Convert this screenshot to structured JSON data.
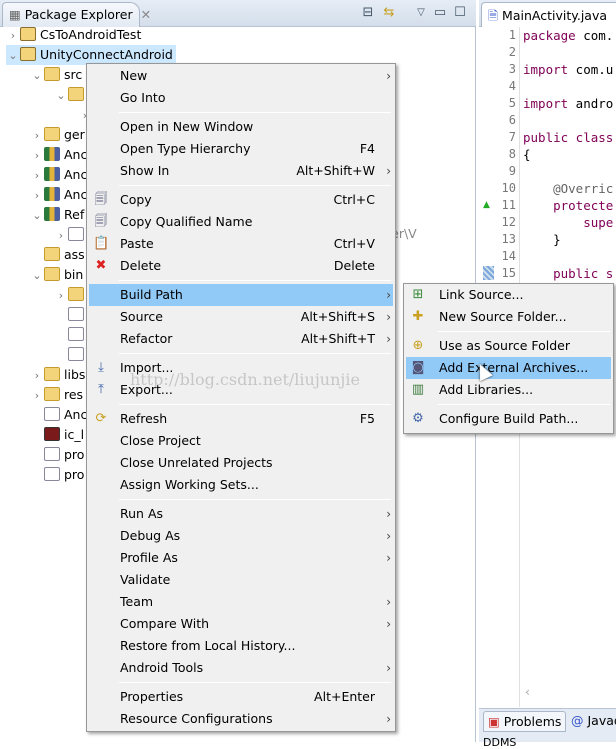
{
  "left_panel": {
    "tab_label": "Package Explorer",
    "tree": [
      {
        "label": "CsToAndroidTest",
        "indent": 0,
        "twisty": ">",
        "icon": "project-icon"
      },
      {
        "label": "UnityConnectAndroid",
        "indent": 0,
        "twisty": "v",
        "icon": "project-icon",
        "selected": true
      },
      {
        "label": "src",
        "indent": 1,
        "twisty": "v",
        "icon": "source-folder-icon"
      },
      {
        "label": "",
        "indent": 2,
        "twisty": "v",
        "icon": "package-icon"
      },
      {
        "label": "",
        "indent": 3,
        "twisty": ">",
        "icon": ""
      },
      {
        "label": "ger",
        "indent": 1,
        "twisty": ">",
        "icon": "source-folder-icon"
      },
      {
        "label": "Anc",
        "indent": 1,
        "twisty": ">",
        "icon": "library-icon"
      },
      {
        "label": "Anc",
        "indent": 1,
        "twisty": ">",
        "icon": "library-icon"
      },
      {
        "label": "Anc",
        "indent": 1,
        "twisty": ">",
        "icon": "library-icon"
      },
      {
        "label": "Ref",
        "indent": 1,
        "twisty": "v",
        "icon": "library-icon"
      },
      {
        "label": "",
        "indent": 2,
        "twisty": ">",
        "icon": "jar-icon"
      },
      {
        "label": "ass",
        "indent": 1,
        "twisty": "",
        "icon": "folder-icon"
      },
      {
        "label": "bin",
        "indent": 1,
        "twisty": "v",
        "icon": "folder-icon"
      },
      {
        "label": "",
        "indent": 2,
        "twisty": ">",
        "icon": "folder-icon"
      },
      {
        "label": "",
        "indent": 2,
        "twisty": "",
        "icon": "android-file-icon"
      },
      {
        "label": "",
        "indent": 2,
        "twisty": "",
        "icon": "file-icon"
      },
      {
        "label": "",
        "indent": 2,
        "twisty": "",
        "icon": "java-file-icon"
      },
      {
        "label": "libs",
        "indent": 1,
        "twisty": ">",
        "icon": "folder-icon"
      },
      {
        "label": "res",
        "indent": 1,
        "twisty": ">",
        "icon": "folder-icon"
      },
      {
        "label": "Anc",
        "indent": 1,
        "twisty": "",
        "icon": "android-file-icon"
      },
      {
        "label": "ic_l",
        "indent": 1,
        "twisty": "",
        "icon": "png-icon"
      },
      {
        "label": "pro",
        "indent": 1,
        "twisty": "",
        "icon": "file-icon"
      },
      {
        "label": "pro",
        "indent": 1,
        "twisty": "",
        "icon": "file-icon"
      }
    ],
    "obscured_text": "oidPlayer\\V"
  },
  "editor": {
    "tab_label": "MainActivity.java",
    "lines": [
      {
        "n": "1",
        "kw": "package",
        "rest": " com."
      },
      {
        "n": "2",
        "kw": "",
        "rest": ""
      },
      {
        "n": "3",
        "kw": "import",
        "rest": " com.u"
      },
      {
        "n": "4",
        "kw": "",
        "rest": ""
      },
      {
        "n": "5",
        "kw": "import",
        "rest": " andro"
      },
      {
        "n": "6",
        "kw": "",
        "rest": ""
      },
      {
        "n": "7",
        "kw": "public class",
        "rest": ""
      },
      {
        "n": "8",
        "kw": "",
        "rest": "{"
      },
      {
        "n": "9",
        "kw": "",
        "rest": ""
      },
      {
        "n": "10",
        "kw": "",
        "rest": "    @Overric"
      },
      {
        "n": "11",
        "kw": "    protecte",
        "rest": ""
      },
      {
        "n": "12",
        "kw": "        supe",
        "rest": ""
      },
      {
        "n": "13",
        "kw": "",
        "rest": "    }"
      },
      {
        "n": "14",
        "kw": "",
        "rest": ""
      },
      {
        "n": "15",
        "kw": "    public s",
        "rest": ""
      }
    ]
  },
  "bottom_tabs": [
    "Problems",
    "Javadoc"
  ],
  "bottom_status": "DDMS",
  "context_menu": {
    "items": [
      {
        "label": "New",
        "shortcut": "",
        "submenu": true
      },
      {
        "label": "Go Into",
        "shortcut": "",
        "submenu": false
      },
      {
        "sep": true
      },
      {
        "label": "Open in New Window",
        "shortcut": "",
        "submenu": false
      },
      {
        "label": "Open Type Hierarchy",
        "shortcut": "F4",
        "submenu": false
      },
      {
        "label": "Show In",
        "shortcut": "Alt+Shift+W",
        "submenu": true
      },
      {
        "sep": true
      },
      {
        "label": "Copy",
        "shortcut": "Ctrl+C",
        "submenu": false,
        "icon": "copy-icon"
      },
      {
        "label": "Copy Qualified Name",
        "shortcut": "",
        "submenu": false,
        "icon": "copy-qualified-icon"
      },
      {
        "label": "Paste",
        "shortcut": "Ctrl+V",
        "submenu": false,
        "icon": "paste-icon"
      },
      {
        "label": "Delete",
        "shortcut": "Delete",
        "submenu": false,
        "icon": "delete-icon"
      },
      {
        "sep": true
      },
      {
        "label": "Build Path",
        "shortcut": "",
        "submenu": true,
        "highlighted": true
      },
      {
        "label": "Source",
        "shortcut": "Alt+Shift+S",
        "submenu": true
      },
      {
        "label": "Refactor",
        "shortcut": "Alt+Shift+T",
        "submenu": true
      },
      {
        "sep": true
      },
      {
        "label": "Import...",
        "shortcut": "",
        "submenu": false,
        "icon": "import-icon"
      },
      {
        "label": "Export...",
        "shortcut": "",
        "submenu": false,
        "icon": "export-icon"
      },
      {
        "sep": true
      },
      {
        "label": "Refresh",
        "shortcut": "F5",
        "submenu": false,
        "icon": "refresh-icon"
      },
      {
        "label": "Close Project",
        "shortcut": "",
        "submenu": false
      },
      {
        "label": "Close Unrelated Projects",
        "shortcut": "",
        "submenu": false
      },
      {
        "label": "Assign Working Sets...",
        "shortcut": "",
        "submenu": false
      },
      {
        "sep": true
      },
      {
        "label": "Run As",
        "shortcut": "",
        "submenu": true
      },
      {
        "label": "Debug As",
        "shortcut": "",
        "submenu": true
      },
      {
        "label": "Profile As",
        "shortcut": "",
        "submenu": true
      },
      {
        "label": "Validate",
        "shortcut": "",
        "submenu": false
      },
      {
        "label": "Team",
        "shortcut": "",
        "submenu": true
      },
      {
        "label": "Compare With",
        "shortcut": "",
        "submenu": true
      },
      {
        "label": "Restore from Local History...",
        "shortcut": "",
        "submenu": false
      },
      {
        "label": "Android Tools",
        "shortcut": "",
        "submenu": true
      },
      {
        "sep": true
      },
      {
        "label": "Properties",
        "shortcut": "Alt+Enter",
        "submenu": false
      },
      {
        "label": "Resource Configurations",
        "shortcut": "",
        "submenu": true
      }
    ]
  },
  "build_path_submenu": {
    "items": [
      {
        "label": "Link Source...",
        "icon": "link-source-icon"
      },
      {
        "label": "New Source Folder...",
        "icon": "new-source-folder-icon"
      },
      {
        "sep": true
      },
      {
        "label": "Use as Source Folder",
        "icon": "use-source-folder-icon"
      },
      {
        "label": "Add External Archives...",
        "icon": "jar-icon",
        "highlighted": true
      },
      {
        "label": "Add Libraries...",
        "icon": "library-icon"
      },
      {
        "sep": true
      },
      {
        "label": "Configure Build Path...",
        "icon": "configure-build-path-icon"
      }
    ]
  },
  "watermark": "http://blog.csdn.net/liujunjie",
  "colors": {
    "highlight": "#91c9f7",
    "selection": "#cce8ff",
    "keyword": "#7f0055"
  }
}
